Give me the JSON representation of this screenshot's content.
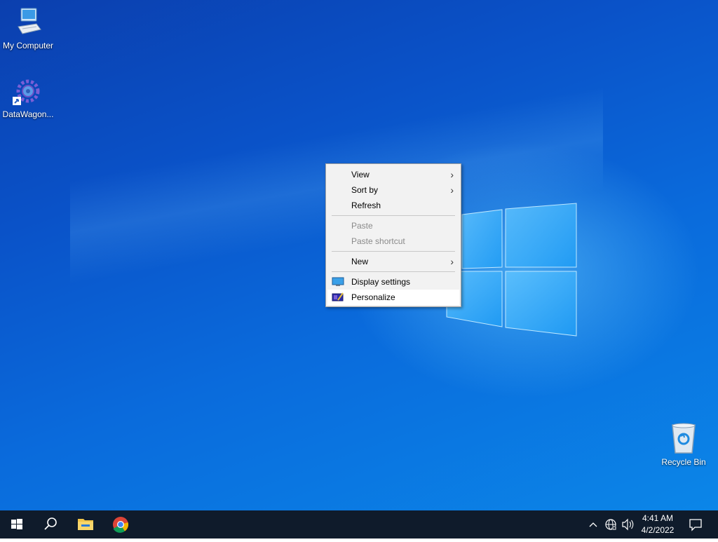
{
  "desktop": {
    "icons": [
      {
        "label": "My Computer"
      },
      {
        "label": "DataWagon..."
      },
      {
        "label": "Recycle Bin"
      }
    ]
  },
  "context_menu": {
    "items": [
      {
        "label": "View",
        "submenu": true
      },
      {
        "label": "Sort by",
        "submenu": true
      },
      {
        "label": "Refresh"
      },
      {
        "label": "Paste",
        "disabled": true
      },
      {
        "label": "Paste shortcut",
        "disabled": true
      },
      {
        "label": "New",
        "submenu": true
      },
      {
        "label": "Display settings",
        "icon": "display-icon"
      },
      {
        "label": "Personalize",
        "icon": "personalize-icon"
      }
    ],
    "chevron": "›"
  },
  "taskbar": {
    "start": "windows-start-icon",
    "search": "search-icon",
    "pinned": [
      "file-explorer-icon",
      "chrome-icon"
    ],
    "tray": [
      "chevron-up-icon",
      "network-icon",
      "volume-icon",
      "notification-icon"
    ],
    "time": "4:41 AM",
    "date": "4/2/2022"
  },
  "colors": {
    "taskbar": "#0f1b2b",
    "menu_bg": "#f2f2f2",
    "disabled_text": "#8a8a8a",
    "desktop_accent": "#0a6bdc"
  }
}
